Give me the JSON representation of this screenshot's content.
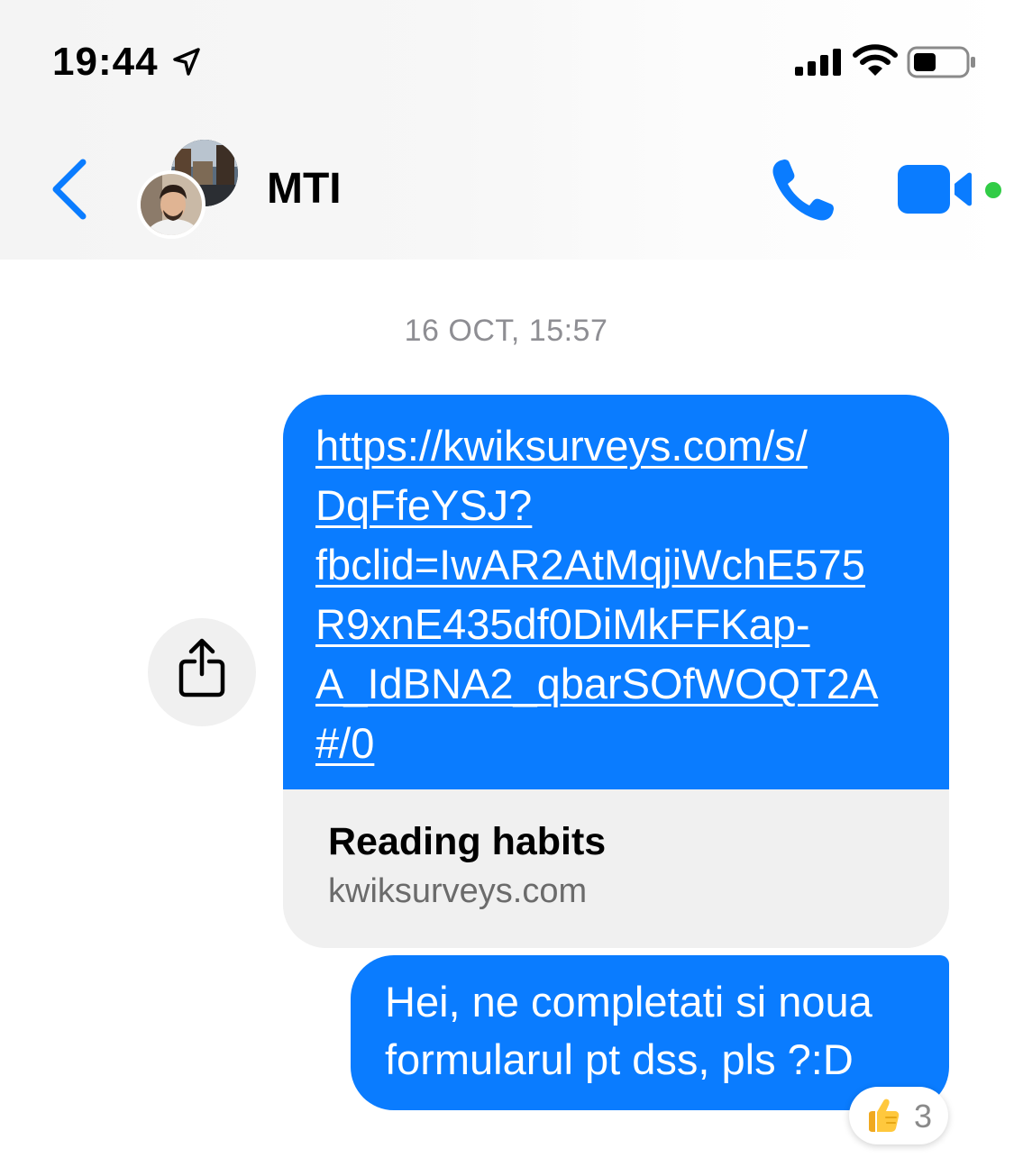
{
  "status_bar": {
    "time": "19:44"
  },
  "nav": {
    "title": "MTI"
  },
  "conversation": {
    "timestamp": "16 OCT, 15:57",
    "link_message": {
      "url_text": "https://kwiksurveys.com/s/\nDqFfeYSJ?\nfbclid=IwAR2AtMqjiWchE575\nR9xnE435df0DiMkFFKap-\nA_IdBNA2_qbarSOfWOQT2A\n#/0",
      "preview_title": "Reading habits",
      "preview_domain": "kwiksurveys.com"
    },
    "text_message": {
      "text": "Hei, ne completati si noua\nformularul pt dss, pls ?:D"
    },
    "reaction": {
      "emoji": "thumbs-up",
      "count": "3"
    }
  },
  "colors": {
    "accent": "#0a7cff",
    "online": "#31cc46",
    "preview_bg": "#f0f0f0"
  }
}
